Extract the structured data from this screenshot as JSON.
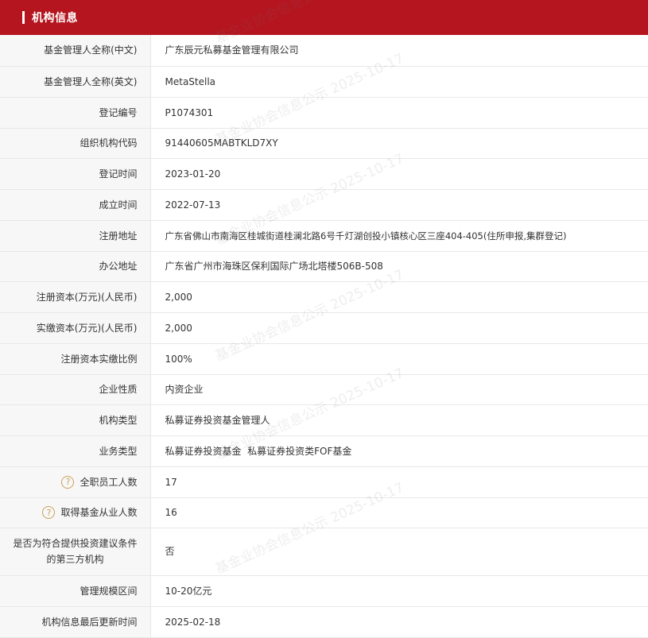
{
  "header": {
    "title": "机构信息"
  },
  "watermark": "基金业协会信息公示 2025-10-17",
  "rows": [
    {
      "label": "基金管理人全称(中文)",
      "value": "广东辰元私募基金管理有限公司"
    },
    {
      "label": "基金管理人全称(英文)",
      "value": "MetaStella"
    },
    {
      "label": "登记编号",
      "value": "P1074301"
    },
    {
      "label": "组织机构代码",
      "value": "91440605MABTKLD7XY"
    },
    {
      "label": "登记时间",
      "value": "2023-01-20"
    },
    {
      "label": "成立时间",
      "value": "2022-07-13"
    },
    {
      "label": "注册地址",
      "value": "广东省佛山市南海区桂城街道桂澜北路6号千灯湖创投小镇核心区三座404-405(住所申报,集群登记)"
    },
    {
      "label": "办公地址",
      "value": "广东省广州市海珠区保利国际广场北塔楼506B-508"
    },
    {
      "label": "注册资本(万元)(人民币)",
      "value": "2,000"
    },
    {
      "label": "实缴资本(万元)(人民币)",
      "value": "2,000"
    },
    {
      "label": "注册资本实缴比例",
      "value": "100%"
    },
    {
      "label": "企业性质",
      "value": "内资企业"
    },
    {
      "label": "机构类型",
      "value": "私募证券投资基金管理人"
    },
    {
      "label": "业务类型",
      "value": "私募证券投资基金  私募证券投资类FOF基金"
    },
    {
      "label": "全职员工人数",
      "value": "17"
    },
    {
      "label": "取得基金从业人数",
      "value": "16"
    },
    {
      "label_line1": "是否为符合提供投资建议条件",
      "label_line2": "的第三方机构",
      "value": "否"
    },
    {
      "label": "管理规模区间",
      "value": "10-20亿元"
    },
    {
      "label": "机构信息最后更新时间",
      "value": "2025-02-18"
    }
  ],
  "help_icon": "question-mark-icon"
}
